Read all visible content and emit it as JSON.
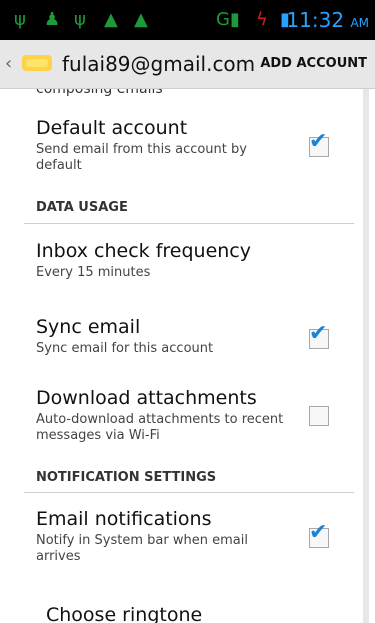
{
  "status_bar": {
    "icons": [
      "usb-icon",
      "android-icon",
      "usb-icon",
      "warning-icon",
      "warning-icon",
      "signal-icon",
      "charging-icon",
      "battery-icon"
    ],
    "time": "11:32",
    "ampm": "AM"
  },
  "action_bar": {
    "email": "fulai89@gmail.com",
    "add_account_label": "ADD ACCOUNT"
  },
  "top_cut_text": "composing emails",
  "prefs": {
    "default_account": {
      "title": "Default account",
      "summary": "Send email from this account by default",
      "checked": true
    },
    "data_usage_header": "DATA USAGE",
    "inbox_check": {
      "title": "Inbox check frequency",
      "summary": "Every 15 minutes"
    },
    "sync_email": {
      "title": "Sync email",
      "summary": "Sync email for this account",
      "checked": true
    },
    "download_attachments": {
      "title": "Download attachments",
      "summary": "Auto-download attachments to recent messages via Wi-Fi",
      "checked": false
    },
    "notification_header": "NOTIFICATION SETTINGS",
    "email_notifications": {
      "title": "Email notifications",
      "summary": "Notify in System bar when email arrives",
      "checked": true
    },
    "choose_ringtone": {
      "title": "Choose ringtone"
    }
  }
}
